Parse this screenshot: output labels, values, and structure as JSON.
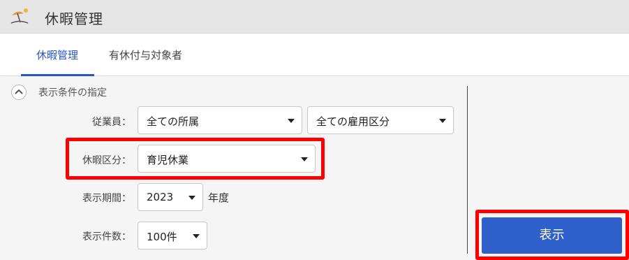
{
  "app": {
    "title": "休暇管理",
    "icon": "beach-umbrella-icon"
  },
  "tabs": [
    {
      "label": "休暇管理",
      "active": true
    },
    {
      "label": "有休付与対象者",
      "active": false
    }
  ],
  "filter": {
    "section_title": "表示条件の指定",
    "employee_label": "従業員：",
    "department_value": "全ての所属",
    "employment_value": "全ての雇用区分",
    "leave_type_label": "休暇区分：",
    "leave_type_value": "育児休業",
    "period_label": "表示期間：",
    "period_value": "2023",
    "period_unit": "年度",
    "count_label": "表示件数：",
    "count_value": "100件"
  },
  "show_button_label": "表示",
  "colors": {
    "accent": "#2a55c4",
    "button": "#2f5fc8",
    "highlight": "#ff0000"
  }
}
